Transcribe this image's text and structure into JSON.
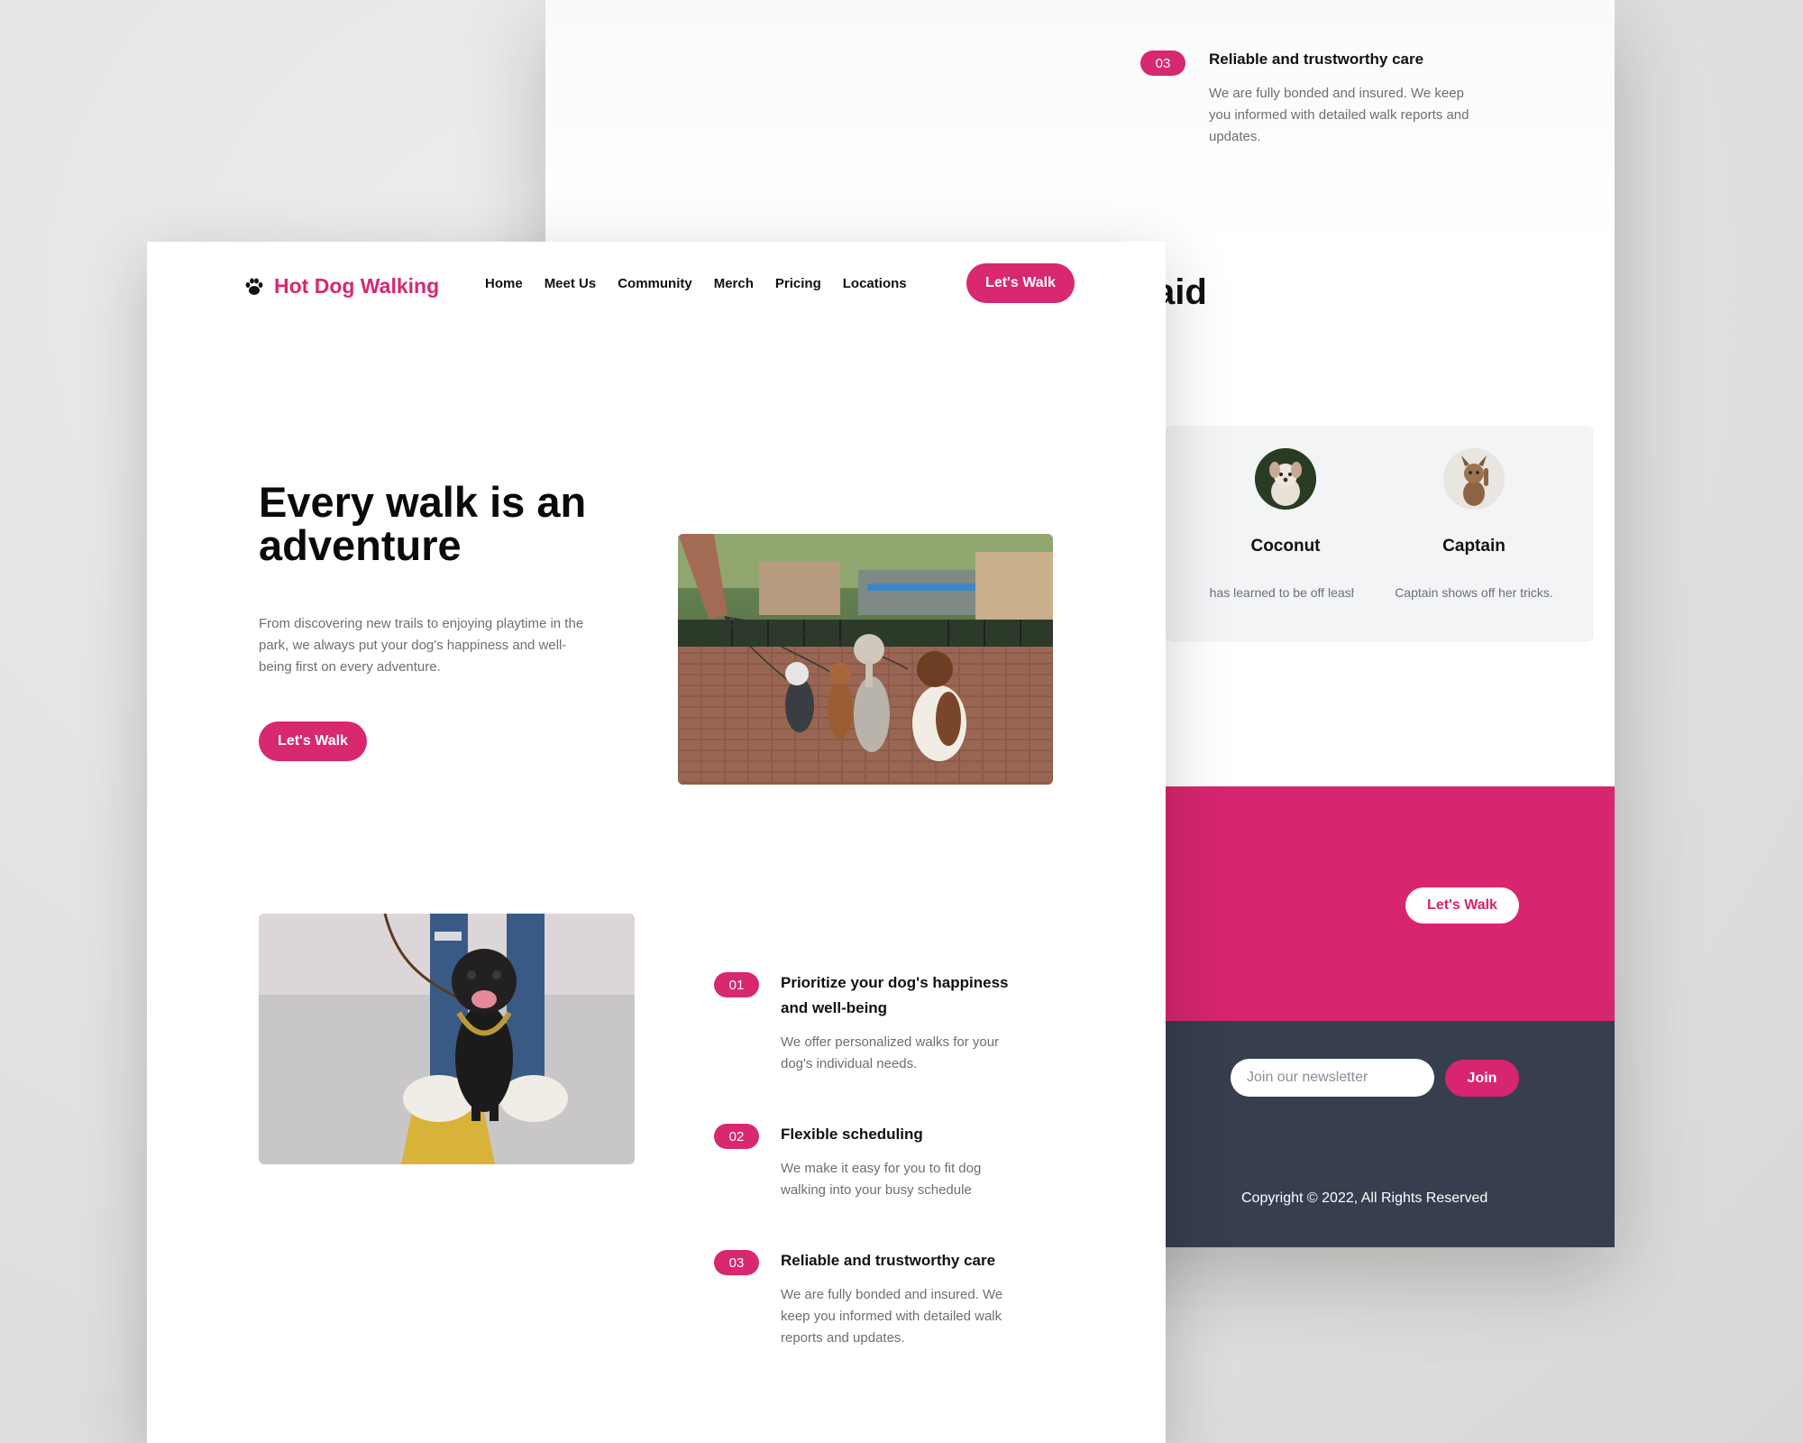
{
  "brand": {
    "name": "Hot Dog Walking",
    "accent": "#d8286f"
  },
  "nav": {
    "links": [
      "Home",
      "Meet Us",
      "Community",
      "Merch",
      "Pricing",
      "Locations"
    ],
    "cta": "Let's Walk"
  },
  "hero": {
    "title": "Every walk is an adventure",
    "text": "From discovering new trails to enjoying playtime in the park, we always put your dog's happiness and well-being first on every adventure.",
    "cta": "Let's Walk"
  },
  "steps": [
    {
      "num": "01",
      "title": "Prioritize your dog's happiness and well-being",
      "desc": "We offer personalized walks for your dog's individual needs."
    },
    {
      "num": "02",
      "title": "Flexible scheduling",
      "desc": "We make it easy for you to fit dog walking into your busy schedule"
    },
    {
      "num": "03",
      "title": "Reliable and trustworthy care",
      "desc": "We are fully bonded and insured. We keep you informed with detailed walk reports and updates."
    }
  ],
  "back_page": {
    "step": {
      "num": "03",
      "title": "Reliable and trustworthy care",
      "desc": "We are fully bonded and insured. We keep you informed with detailed walk reports and updates."
    },
    "heading_fragment": "aid",
    "testimonials": [
      {
        "name": "Coconut",
        "quote": "has learned to be off leash!"
      },
      {
        "name": "Captain",
        "quote": "Captain shows off her tricks."
      }
    ],
    "cta": "Let's Walk",
    "newsletter_placeholder": "Join our newsletter",
    "join": "Join",
    "footer_fragment": "s",
    "copyright": "Copyright © 2022, All Rights Reserved"
  },
  "colors": {
    "accent": "#d8286f",
    "footer_bg": "#373e4e",
    "card_bg": "#f3f4f6"
  },
  "icons": {
    "brand_icon": "paw-icon"
  }
}
